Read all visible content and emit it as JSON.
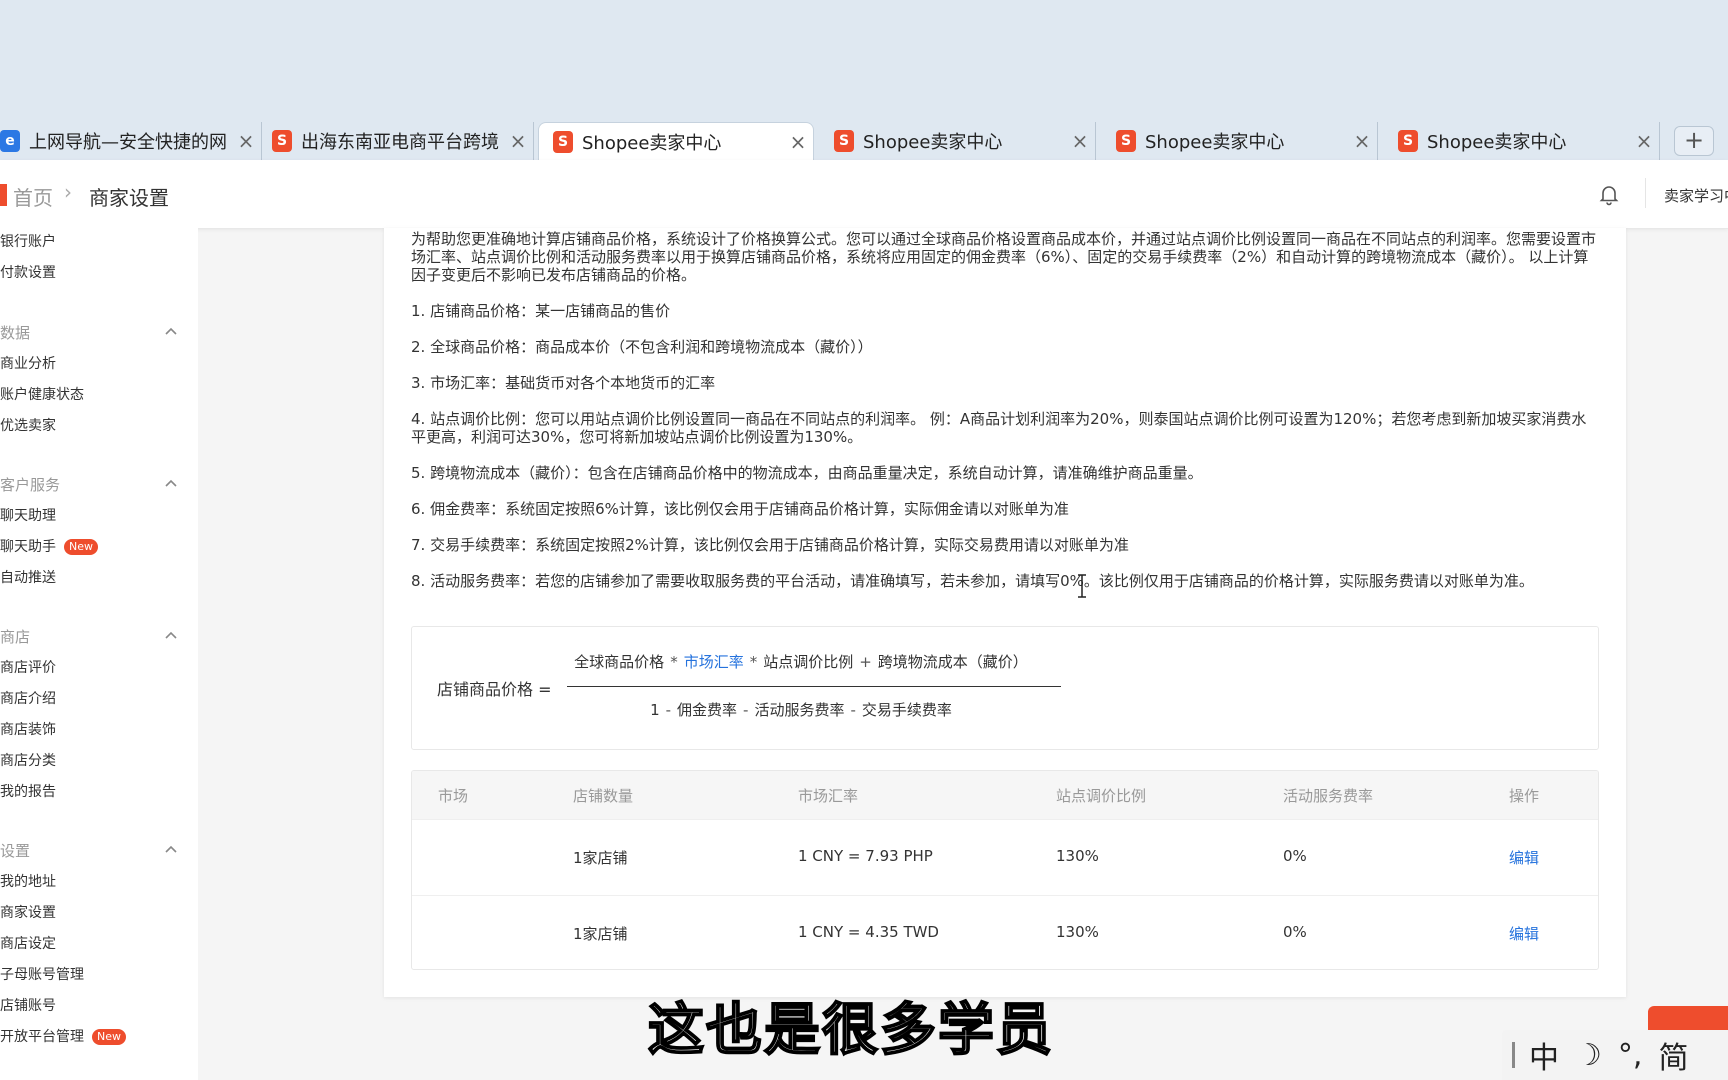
{
  "tabs": [
    {
      "title": "上网导航—安全快捷的网",
      "icon": "nav-icon",
      "active": false
    },
    {
      "title": "出海东南亚电商平台跨境",
      "icon": "shopee-icon",
      "active": false
    },
    {
      "title": "Shopee卖家中心",
      "icon": "shopee-icon",
      "active": true
    },
    {
      "title": "Shopee卖家中心",
      "icon": "shopee-icon",
      "active": false
    },
    {
      "title": "Shopee卖家中心",
      "icon": "shopee-icon",
      "active": false
    },
    {
      "title": "Shopee卖家中心",
      "icon": "shopee-icon",
      "active": false
    }
  ],
  "tab_close": "×",
  "new_tab": "+",
  "header": {
    "home": "首页",
    "separator": "›",
    "current": "商家设置",
    "user_label": "卖家学习中"
  },
  "sidebar": {
    "top_items": [
      "银行账户",
      "付款设置"
    ],
    "groups": [
      {
        "label": "数据",
        "items": [
          {
            "label": "商业分析"
          },
          {
            "label": "账户健康状态"
          },
          {
            "label": "优选卖家"
          }
        ]
      },
      {
        "label": "客户服务",
        "items": [
          {
            "label": "聊天助理"
          },
          {
            "label": "聊天助手",
            "badge": "New"
          },
          {
            "label": "自动推送"
          }
        ]
      },
      {
        "label": "商店",
        "items": [
          {
            "label": "商店评价"
          },
          {
            "label": "商店介绍"
          },
          {
            "label": "商店装饰"
          },
          {
            "label": "商店分类"
          },
          {
            "label": "我的报告"
          }
        ]
      },
      {
        "label": "设置",
        "items": [
          {
            "label": "我的地址"
          },
          {
            "label": "商家设置"
          },
          {
            "label": "商店设定"
          },
          {
            "label": "子母账号管理"
          },
          {
            "label": "店铺账号"
          },
          {
            "label": "开放平台管理",
            "badge": "New"
          }
        ]
      }
    ]
  },
  "content": {
    "intro": "为帮助您更准确地计算店铺商品价格，系统设计了价格换算公式。您可以通过全球商品价格设置商品成本价，并通过站点调价比例设置同一商品在不同站点的利润率。您需要设置市场汇率、站点调价比例和活动服务费率以用于换算店铺商品价格，系统将应用固定的佣金费率（6%）、固定的交易手续费率（2%）和自动计算的跨境物流成本（藏价）。 以上计算因子变更后不影响已发布店铺商品的价格。",
    "definitions": [
      "1. 店铺商品价格：某一店铺商品的售价",
      "2. 全球商品价格：商品成本价（不包含利润和跨境物流成本（藏价））",
      "3. 市场汇率：基础货币对各个本地货币的汇率",
      "4. 站点调价比例：您可以用站点调价比例设置同一商品在不同站点的利润率。 例：A商品计划利润率为20%，则泰国站点调价比例可设置为120%；若您考虑到新加坡买家消费水平更高，利润可达30%，您可将新加坡站点调价比例设置为130%。",
      "5. 跨境物流成本（藏价）：包含在店铺商品价格中的物流成本，由商品重量决定，系统自动计算，请准确维护商品重量。",
      "6. 佣金费率：系统固定按照6%计算，该比例仅会用于店铺商品价格计算，实际佣金请以对账单为准",
      "7. 交易手续费率：系统固定按照2%计算，该比例仅会用于店铺商品价格计算，实际交易费用请以对账单为准",
      "8. 活动服务费率：若您的店铺参加了需要收取服务费的平台活动，请准确填写，若未参加，请填写0%。该比例仅用于店铺商品的价格计算，实际服务费请以对账单为准。"
    ]
  },
  "formula": {
    "lhs": "店铺商品价格 =",
    "num_a": "全球商品价格",
    "num_op1": "*",
    "num_b": "市场汇率",
    "num_op2": "*",
    "num_c": "站点调价比例",
    "num_op3": "+",
    "num_d": "跨境物流成本（藏价）",
    "den_a": "1",
    "den_op1": "-",
    "den_b": "佣金费率",
    "den_op2": "-",
    "den_c": "活动服务费率",
    "den_op3": "-",
    "den_d": "交易手续费率"
  },
  "table": {
    "columns": [
      "市场",
      "店铺数量",
      "市场汇率",
      "站点调价比例",
      "活动服务费率",
      "操作"
    ],
    "rows": [
      {
        "market": "",
        "stores": "1家店铺",
        "rate": "1 CNY = 7.93 PHP",
        "ratio": "130%",
        "fee": "0%",
        "action": "编辑"
      },
      {
        "market": "",
        "stores": "1家店铺",
        "rate": "1 CNY = 4.35 TWD",
        "ratio": "130%",
        "fee": "0%",
        "action": "编辑"
      }
    ]
  },
  "caption": "这也是很多学员",
  "ime": {
    "lang": "中",
    "moon": "☽",
    "punct": "°,",
    "mode": "简"
  },
  "colors": {
    "brand": "#ee4d2d",
    "link": "#2673dd"
  }
}
